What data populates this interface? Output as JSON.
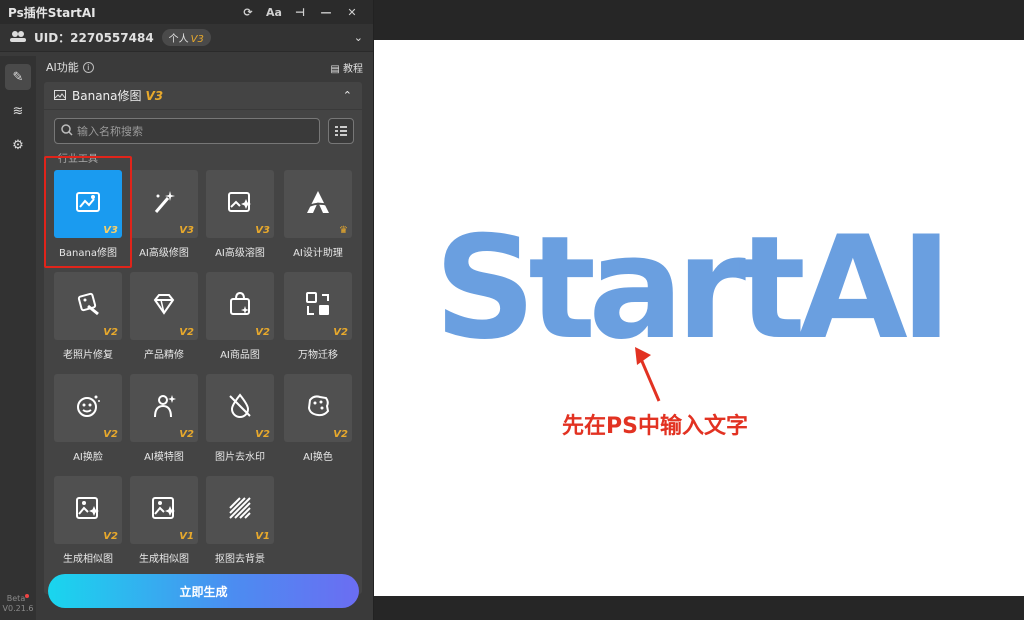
{
  "window": {
    "title": "Ps插件StartAI"
  },
  "user": {
    "uid": "UID：2270557484",
    "tier": "个人",
    "tier_level": "V3"
  },
  "section": {
    "title": "AI功能",
    "tutorial": "教程"
  },
  "accordion": {
    "title": "Banana修图",
    "version": "V3"
  },
  "search": {
    "placeholder": "输入名称搜索"
  },
  "category_label": "行业工具",
  "tools": [
    {
      "label": "Banana修图",
      "badge": "V3",
      "icon": "image-edit-icon",
      "selected": true
    },
    {
      "label": "AI高级修图",
      "badge": "V3",
      "icon": "magic-wand-icon"
    },
    {
      "label": "AI高级溶图",
      "badge": "V3",
      "icon": "image-sparkle-icon"
    },
    {
      "label": "AI设计助理",
      "badge": "",
      "icon": "design-a-icon",
      "crown": true
    },
    {
      "label": "老照片修复",
      "badge": "V2",
      "icon": "photo-restore-icon"
    },
    {
      "label": "产品精修",
      "badge": "V2",
      "icon": "diamond-icon"
    },
    {
      "label": "AI商品图",
      "badge": "V2",
      "icon": "shopping-bag-icon"
    },
    {
      "label": "万物迁移",
      "badge": "V2",
      "icon": "transfer-icon"
    },
    {
      "label": "AI换脸",
      "badge": "V2",
      "icon": "face-swap-icon"
    },
    {
      "label": "AI模特图",
      "badge": "V2",
      "icon": "model-icon"
    },
    {
      "label": "图片去水印",
      "badge": "V2",
      "icon": "remove-watermark-icon"
    },
    {
      "label": "AI换色",
      "badge": "V2",
      "icon": "palette-icon"
    },
    {
      "label": "生成相似图",
      "badge": "V2",
      "icon": "similar-image-icon"
    },
    {
      "label": "生成相似图",
      "badge": "V1",
      "icon": "similar-image-icon"
    },
    {
      "label": "抠图去背景",
      "badge": "V1",
      "icon": "remove-background-icon"
    }
  ],
  "generate_button": "立即生成",
  "version": {
    "line1": "Beta",
    "line2": "V0.21.6"
  },
  "canvas": {
    "big_text": "StartAI",
    "annotation": "先在PS中输入文字"
  },
  "colors": {
    "accent": "#1a9bf0",
    "badge": "#e8a92c",
    "canvas_text": "#6a9fe0",
    "annotation": "#e23222",
    "highlight_box": "#e0241a"
  }
}
